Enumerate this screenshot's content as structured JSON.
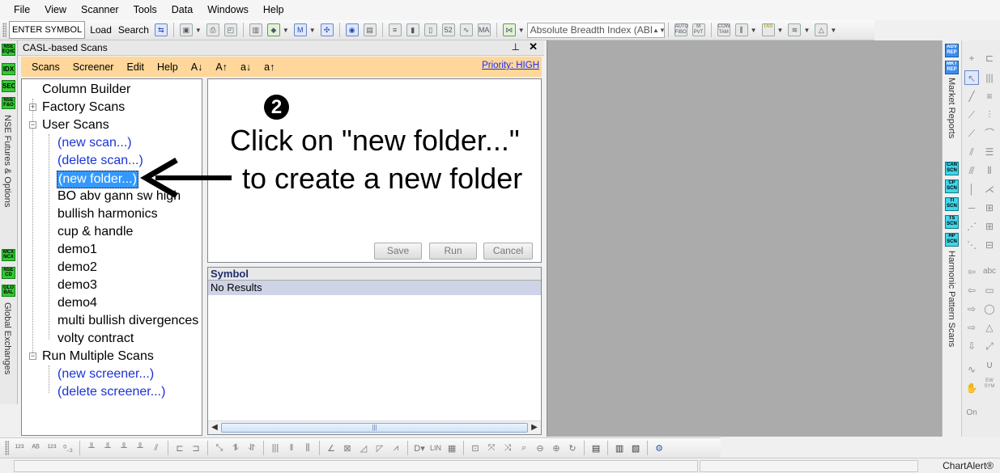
{
  "menu": [
    "File",
    "View",
    "Scanner",
    "Tools",
    "Data",
    "Windows",
    "Help"
  ],
  "toolbar": {
    "enter_symbol": "ENTER SYMBOL",
    "load": "Load",
    "search": "Search",
    "indicator_combo": "Absolute Breadth Index (ABI",
    "auto_fibo": "AUTO FIBO",
    "m_pvt": "M PVT",
    "cow_tam": "COW TAM",
    "tas": "TAS"
  },
  "left_strip": {
    "buttons": [
      "NSE EQ/IDX",
      "IDX",
      "SEC",
      "NSE F&O",
      "MCX NCX",
      "NSE CD",
      "GLO BAL"
    ],
    "label_top": "NSE Futures & Options",
    "label_bottom": "Global Exchanges"
  },
  "panel": {
    "title": "CASL-based Scans",
    "pin": "♐",
    "close": "✕"
  },
  "scanbar": {
    "items": [
      "Scans",
      "Screener",
      "Edit",
      "Help",
      "A↓",
      "A↑",
      "a↓",
      "a↑"
    ],
    "priority": "Priority: HIGH"
  },
  "tree": {
    "column_builder": "Column Builder",
    "factory_scans": "Factory Scans",
    "user_scans": "User Scans",
    "new_scan": "(new scan...)",
    "delete_scan": "(delete scan...)",
    "new_folder": "(new folder...)",
    "scans": [
      "BO abv gann sw high",
      "bullish harmonics",
      "cup & handle",
      "demo1",
      "demo2",
      "demo3",
      "demo4",
      "multi bullish divergences",
      "volty contract"
    ],
    "run_multiple": "Run Multiple Scans",
    "new_screener": "(new screener...)",
    "delete_screener": "(delete screener...)"
  },
  "editor": {
    "save": "Save",
    "run": "Run",
    "cancel": "Cancel"
  },
  "results": {
    "header": "Symbol",
    "row": "No Results"
  },
  "annotation": {
    "step": "2",
    "line1": "Click on \"new folder...\"",
    "line2": "to create a new folder"
  },
  "right_strip": {
    "buttons_top": [
      "ADV REP",
      "MKT REP"
    ],
    "label_top": "Market Reports",
    "buttons_bottom": [
      "CAN SCN",
      "CP SCN",
      "TI SCN",
      "TS SCN",
      "HP SCN"
    ],
    "label_bottom": "Harmonic Pattern Scans"
  },
  "right_tools": {
    "ew_sym": "EW SYM",
    "on": "On",
    "abc": "abc"
  },
  "bottom_bar": {
    "lin": "LIN"
  },
  "status": {
    "brand": "ChartAlert®"
  }
}
